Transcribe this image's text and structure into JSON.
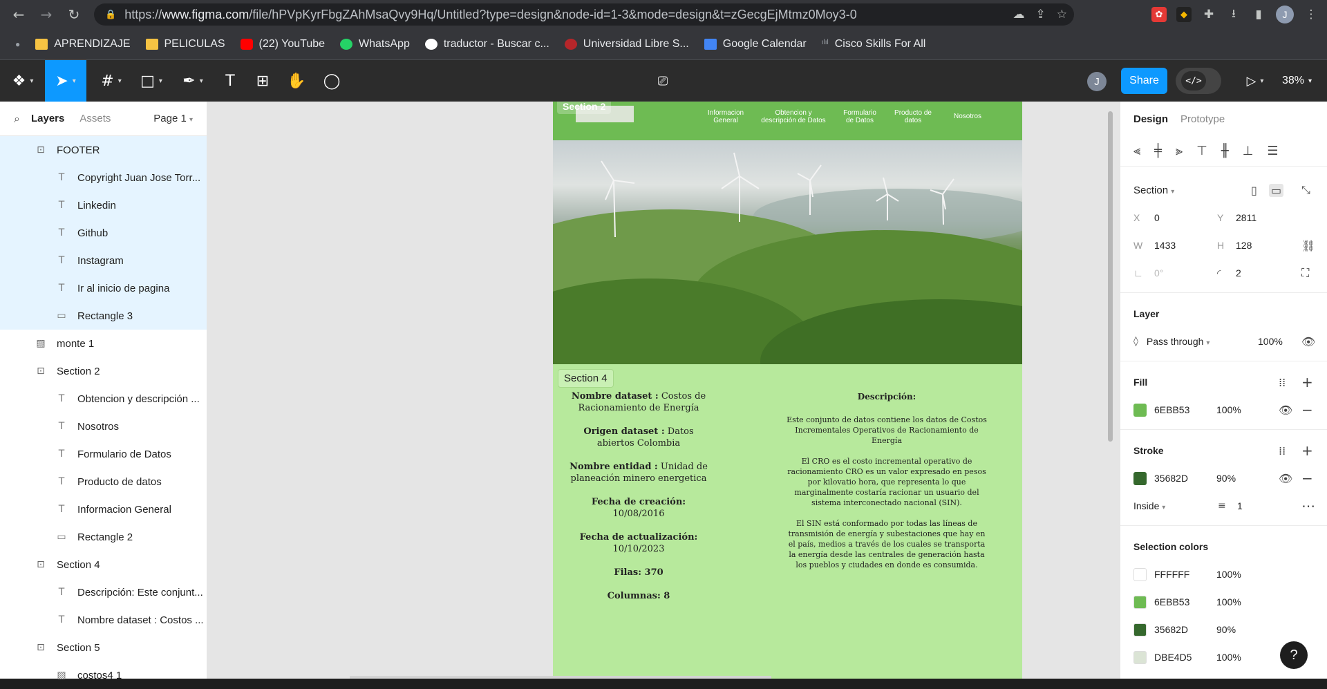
{
  "browser": {
    "url_prefix": "https://",
    "url_host": "www.figma.com",
    "url_path": "/file/hPVpKyrFbgZAhMsaQvy9Hq/Untitled?type=design&node-id=1-3&mode=design&t=zGecgEjMtmz0Moy3-0",
    "profile_initial": "J",
    "bookmarks": [
      {
        "label": "APRENDIZAJE",
        "icon": "folder-icon"
      },
      {
        "label": "PELICULAS",
        "icon": "folder-icon"
      },
      {
        "label": "(22) YouTube",
        "icon": "youtube-icon"
      },
      {
        "label": "WhatsApp",
        "icon": "whatsapp-icon"
      },
      {
        "label": "traductor - Buscar c...",
        "icon": "google-icon"
      },
      {
        "label": "Universidad Libre S...",
        "icon": "university-icon"
      },
      {
        "label": "Google Calendar",
        "icon": "calendar-icon"
      },
      {
        "label": "Cisco Skills For All",
        "icon": "cisco-icon"
      }
    ]
  },
  "toolbar": {
    "avatar_initial": "J",
    "share_label": "Share",
    "code_label": "</>",
    "zoom_label": "38%"
  },
  "left_panel": {
    "tab_layers": "Layers",
    "tab_assets": "Assets",
    "page_label": "Page 1",
    "layers": [
      {
        "name": "FOOTER",
        "type": "frame",
        "selected": true
      },
      {
        "name": "Copyright Juan Jose Torr...",
        "type": "text",
        "selected": true
      },
      {
        "name": "Linkedin",
        "type": "text",
        "selected": true
      },
      {
        "name": "Github",
        "type": "text",
        "selected": true
      },
      {
        "name": "Instagram",
        "type": "text",
        "selected": true
      },
      {
        "name": "Ir al inicio de pagina",
        "type": "text",
        "selected": true
      },
      {
        "name": "Rectangle 3",
        "type": "rect",
        "selected": true
      },
      {
        "name": "monte 1",
        "type": "image",
        "selected": false
      },
      {
        "name": "Section 2",
        "type": "frame",
        "selected": false
      },
      {
        "name": "Obtencion y descripción ...",
        "type": "text",
        "selected": false
      },
      {
        "name": "Nosotros",
        "type": "text",
        "selected": false
      },
      {
        "name": "Formulario de Datos",
        "type": "text",
        "selected": false
      },
      {
        "name": "Producto de datos",
        "type": "text",
        "selected": false
      },
      {
        "name": "Informacion General",
        "type": "text",
        "selected": false
      },
      {
        "name": "Rectangle 2",
        "type": "rect",
        "selected": false
      },
      {
        "name": "Section 4",
        "type": "frame",
        "selected": false
      },
      {
        "name": "Descripción: Este conjunt...",
        "type": "text",
        "selected": false
      },
      {
        "name": "Nombre dataset : Costos ...",
        "type": "text",
        "selected": false
      },
      {
        "name": "Section 5",
        "type": "frame",
        "selected": false
      },
      {
        "name": "costos4 1",
        "type": "image",
        "selected": false
      }
    ]
  },
  "canvas": {
    "section2_label": "Section 2",
    "nav_links": [
      "Informacion General",
      "Obtencion y descripción de Datos",
      "Formulario de Datos",
      "Producto de datos",
      "Nosotros"
    ],
    "section4_label": "Section 4",
    "left_col": {
      "dataset_label": "Nombre dataset :",
      "dataset_value": "Costos de Racionamiento de Energía",
      "origin_label": "Origen dataset :",
      "origin_value": "Datos abiertos Colombia",
      "entity_label": "Nombre entidad :",
      "entity_value": "Unidad de planeación minero energetica",
      "created_label": "Fecha de creación:",
      "created_value": "10/08/2016",
      "updated_label": "Fecha de actualización:",
      "updated_value": "10/10/2023",
      "rows_label": "Filas: 370",
      "cols_label": "Columnas: 8"
    },
    "right_col": {
      "title": "Descripción:",
      "p1": "Este conjunto de datos contiene los datos de Costos Incrementales Operativos de Racionamiento de Energía",
      "p2": "El CRO es el costo incremental operativo de racionamiento CRO es un valor expresado en pesos por kilovatio hora, que representa lo que marginalmente costaría racionar un usuario del sistema interconectado nacional (SIN).",
      "p3": "El SIN está conformado por todas las líneas de transmisión de energía y subestaciones que hay en el país, medios a través de los cuales se transporta la energía desde las centrales de generación hasta los pueblos y ciudades en donde es consumida."
    }
  },
  "right_panel": {
    "tab_design": "Design",
    "tab_prototype": "Prototype",
    "frame_type": "Section",
    "x_label": "X",
    "x_value": "0",
    "y_label": "Y",
    "y_value": "2811",
    "w_label": "W",
    "w_value": "1433",
    "h_label": "H",
    "h_value": "128",
    "rotation_value": "0°",
    "radius_value": "2",
    "layer_title": "Layer",
    "blend_mode": "Pass through",
    "layer_opacity": "100%",
    "fill_title": "Fill",
    "fill_hex": "6EBB53",
    "fill_opacity": "100%",
    "stroke_title": "Stroke",
    "stroke_hex": "35682D",
    "stroke_opacity": "90%",
    "stroke_position": "Inside",
    "stroke_weight": "1",
    "selection_colors_title": "Selection colors",
    "selection_colors": [
      {
        "hex": "FFFFFF",
        "opacity": "100%",
        "color": "#FFFFFF"
      },
      {
        "hex": "6EBB53",
        "opacity": "100%",
        "color": "#6EBB53"
      },
      {
        "hex": "35682D",
        "opacity": "90%",
        "color": "#35682D"
      },
      {
        "hex": "DBE4D5",
        "opacity": "100%",
        "color": "#DBE4D5"
      }
    ],
    "help_label": "?"
  }
}
